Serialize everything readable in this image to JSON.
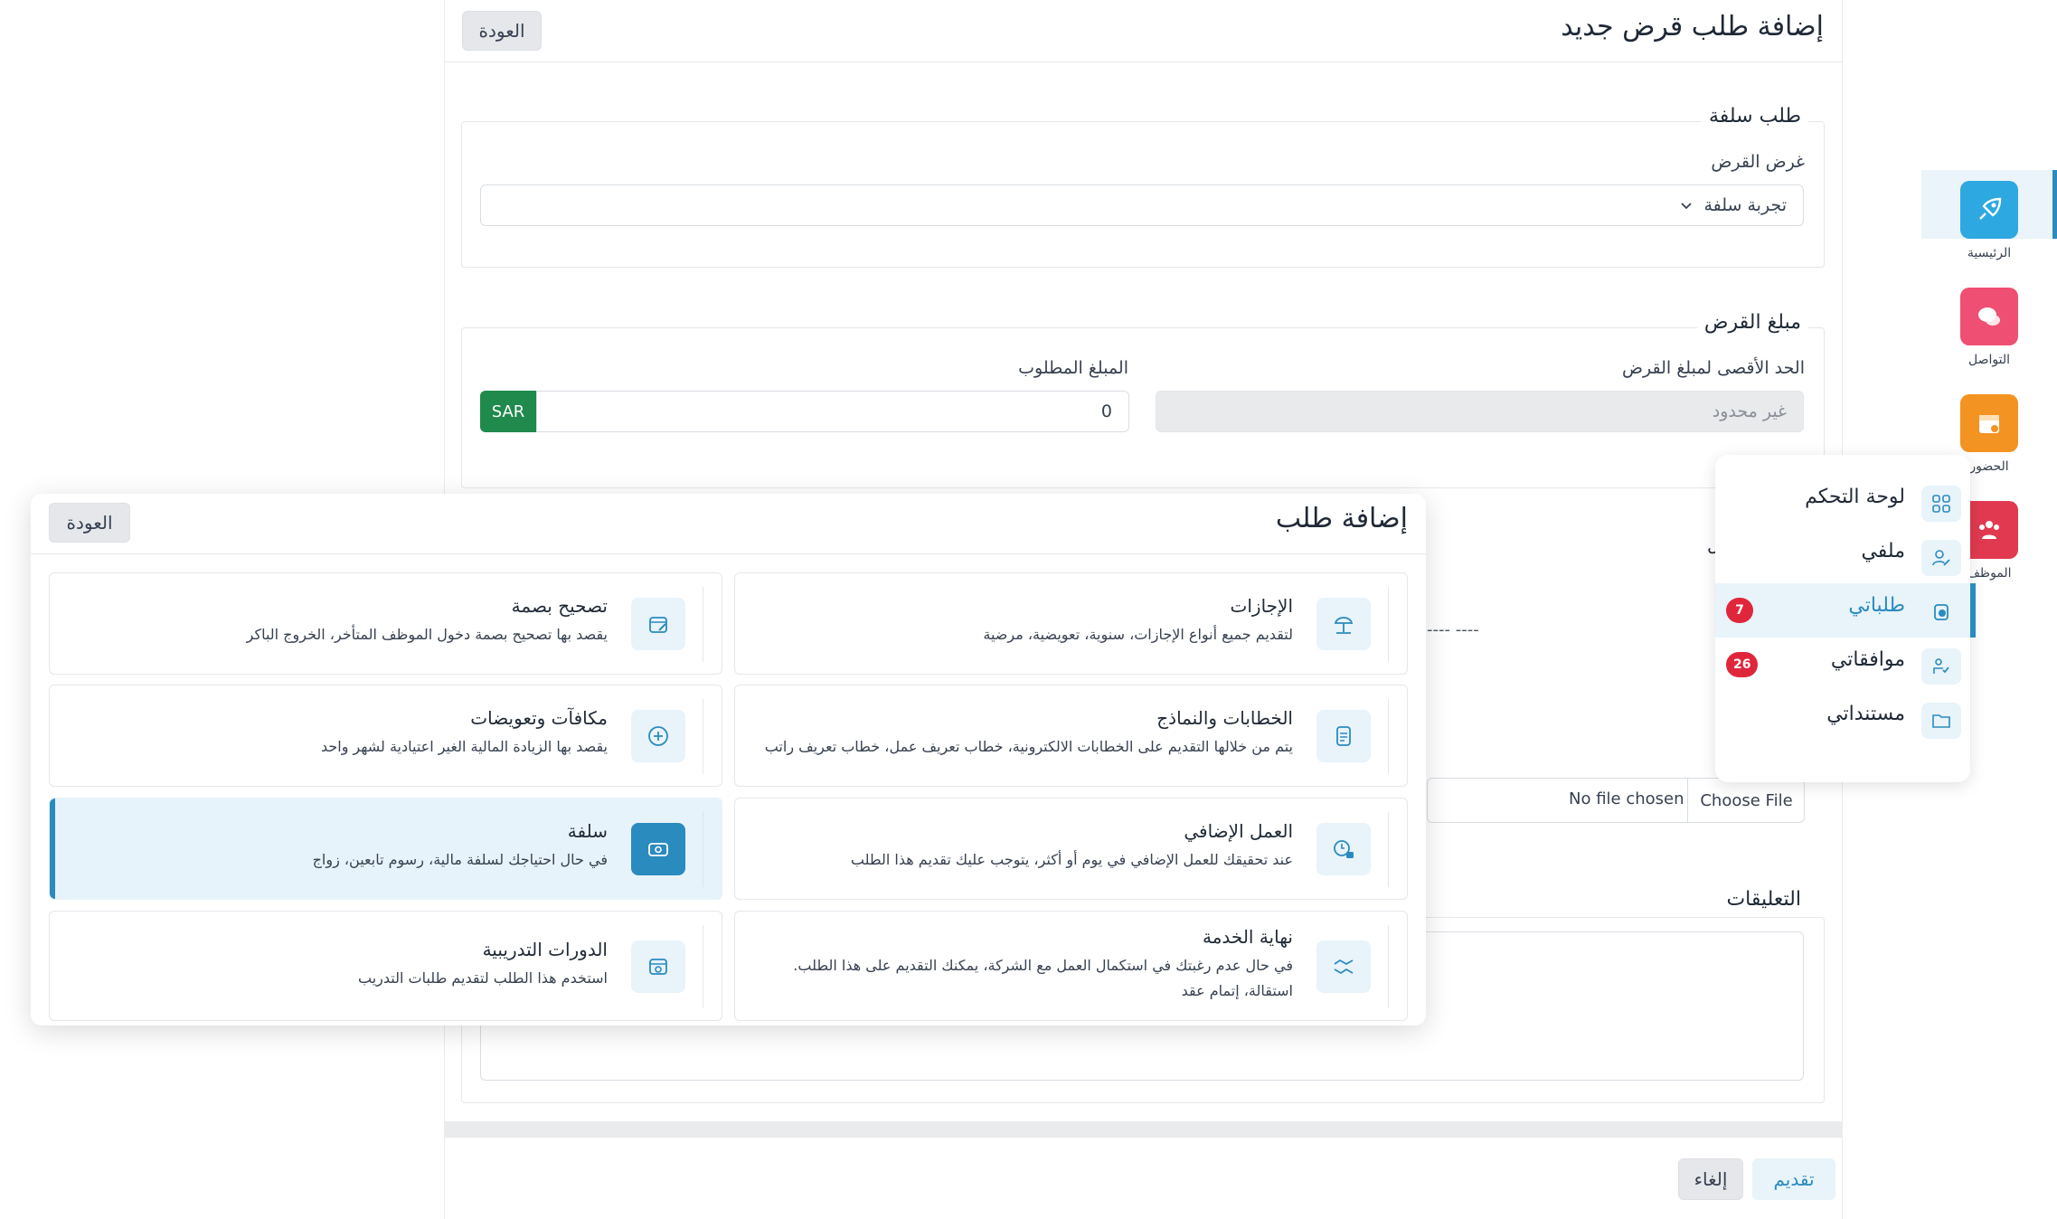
{
  "form": {
    "title": "إضافة طلب قرض جديد",
    "back_label": "العودة",
    "section_loan": "طلب سلفة",
    "purpose_label": "غرض القرض",
    "purpose_value": "تجربة سلفة",
    "section_amount": "مبلغ القرض",
    "max_label": "الحد الأقصى لمبلغ القرض",
    "max_value": "غير محدود",
    "requested_label": "المبلغ المطلوب",
    "requested_value": "0",
    "currency": "SAR",
    "hidden_section_fragment": "ل",
    "date_placeholder": "---- ----",
    "file_button": "Choose File",
    "file_status": "No file chosen",
    "section_comments": "التعليقات",
    "submit_label": "تقديم",
    "cancel_label": "إلغاء"
  },
  "sidenav": [
    {
      "label": "الرئيسية",
      "icon": "rocket-icon",
      "color": "#2ea8e0"
    },
    {
      "label": "التواصل",
      "icon": "chat-icon",
      "color": "#ef4f72"
    },
    {
      "label": "الحضور",
      "icon": "calendar-icon",
      "color": "#f39322"
    },
    {
      "label": "الموظف",
      "icon": "people-icon",
      "color": "#e13a50"
    }
  ],
  "menu": {
    "items": [
      {
        "label": "لوحة التحكم",
        "icon": "dashboard-icon",
        "badge": ""
      },
      {
        "label": "ملفي",
        "icon": "user-edit-icon",
        "badge": ""
      },
      {
        "label": "طلباتي",
        "icon": "requests-icon",
        "badge": "7"
      },
      {
        "label": "موافقاتي",
        "icon": "approvals-icon",
        "badge": "26"
      },
      {
        "label": "مستنداتي",
        "icon": "folder-icon",
        "badge": ""
      }
    ]
  },
  "modal": {
    "title": "إضافة طلب",
    "back_label": "العودة",
    "cards": [
      {
        "title": "الإجازات",
        "desc": "لتقديم جميع أنواع الإجازات، سنوية، تعويضية، مرضية",
        "icon": "vacation-icon"
      },
      {
        "title": "تصحيح بصمة",
        "desc": "يقصد بها تصحيح بصمة دخول الموظف المتأخر، الخروج الباكر",
        "icon": "calendar-edit-icon"
      },
      {
        "title": "الخطابات والنماذج",
        "desc": "يتم من خلالها التقديم على الخطابات الالكترونية، خطاب تعريف عمل، خطاب تعريف راتب",
        "icon": "document-icon"
      },
      {
        "title": "مكافآت وتعويضات",
        "desc": "يقصد بها الزيادة المالية الغير اعتيادية لشهر واحد",
        "icon": "plus-circle-icon"
      },
      {
        "title": "العمل الإضافي",
        "desc": "عند تحقيقك للعمل الإضافي في يوم أو أكثر، يتوجب عليك تقديم هذا الطلب",
        "icon": "clock-lock-icon"
      },
      {
        "title": "سلفة",
        "desc": "في حال احتياجك لسلفة مالية، رسوم تابعين، زواج",
        "icon": "cash-icon"
      },
      {
        "title": "نهاية الخدمة",
        "desc": "في حال عدم رغبتك في استكمال العمل مع الشركة، يمكنك التقديم على هذا الطلب. استقالة، إتمام عقد",
        "icon": "handshake-icon"
      },
      {
        "title": "الدورات التدريبية",
        "desc": "استخدم هذا الطلب لتقديم طلبات التدريب",
        "icon": "training-icon"
      }
    ]
  },
  "colors": {
    "accent": "#2a8bbf",
    "sar": "#1f8a4c",
    "badge": "#e0263b"
  }
}
